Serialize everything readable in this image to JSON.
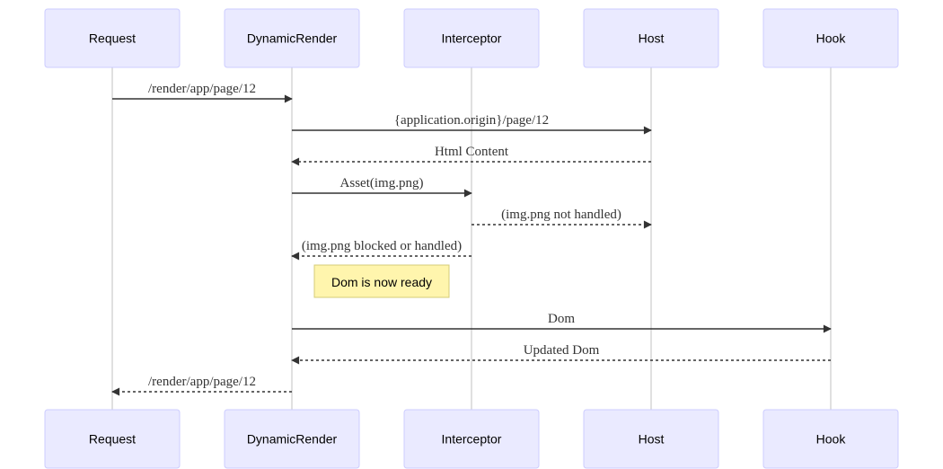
{
  "diagram": {
    "type": "sequence",
    "colors": {
      "actor_fill": "#eaeaff",
      "actor_border": "#ccccff",
      "lifeline": "#d6d6d6",
      "message": "#333333",
      "note_fill": "#fff5ad",
      "note_border": "#d4cc79"
    },
    "actors": [
      {
        "id": "request",
        "label": "Request"
      },
      {
        "id": "dynamicrender",
        "label": "DynamicRender"
      },
      {
        "id": "interceptor",
        "label": "Interceptor"
      },
      {
        "id": "host",
        "label": "Host"
      },
      {
        "id": "hook",
        "label": "Hook"
      }
    ],
    "steps": [
      {
        "kind": "message",
        "from": 0,
        "to": 1,
        "style": "solid",
        "label": "/render/app/page/12"
      },
      {
        "kind": "message",
        "from": 1,
        "to": 3,
        "style": "solid",
        "label": "{application.origin}/page/12"
      },
      {
        "kind": "message",
        "from": 3,
        "to": 1,
        "style": "dashed",
        "label": "Html Content"
      },
      {
        "kind": "message",
        "from": 1,
        "to": 2,
        "style": "solid",
        "label": "Asset(img.png)"
      },
      {
        "kind": "message",
        "from": 2,
        "to": 3,
        "style": "dashed",
        "label": "(img.png not handled)"
      },
      {
        "kind": "message",
        "from": 2,
        "to": 1,
        "style": "dashed",
        "label": "(img.png blocked or handled)"
      },
      {
        "kind": "note",
        "over": 1,
        "placement": "right",
        "label": "Dom is now ready"
      },
      {
        "kind": "message",
        "from": 1,
        "to": 4,
        "style": "solid",
        "label": "Dom"
      },
      {
        "kind": "message",
        "from": 4,
        "to": 1,
        "style": "dashed",
        "label": "Updated Dom"
      },
      {
        "kind": "message",
        "from": 1,
        "to": 0,
        "style": "dashed",
        "label": "/render/app/page/12"
      }
    ]
  }
}
